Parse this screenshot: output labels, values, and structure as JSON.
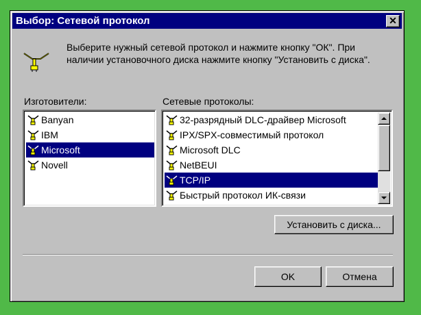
{
  "window": {
    "title": "Выбор: Сетевой протокол",
    "close_symbol": "✕"
  },
  "info": {
    "icon": "network-plug-icon",
    "text": "Выберите нужный сетевой протокол и нажмите кнопку \"ОК\". При наличии установочного диска нажмите кнопку \"Установить с диска\"."
  },
  "manufacturers": {
    "label": "Изготовители:",
    "items": [
      {
        "label": "Banyan"
      },
      {
        "label": "IBM"
      },
      {
        "label": "Microsoft"
      },
      {
        "label": "Novell"
      }
    ],
    "selected": "Microsoft"
  },
  "protocols": {
    "label": "Сетевые протоколы:",
    "items": [
      {
        "label": "32-разрядный DLC-драйвер Microsoft"
      },
      {
        "label": "IPX/SPX-совместимый протокол"
      },
      {
        "label": "Microsoft DLC"
      },
      {
        "label": "NetBEUI"
      },
      {
        "label": "TCP/IP"
      },
      {
        "label": "Быстрый протокол ИК-связи"
      }
    ],
    "selected": "TCP/IP"
  },
  "buttons": {
    "have_disk": "Установить с диска...",
    "ok": "OK",
    "cancel": "Отмена"
  },
  "colors": {
    "desktop": "#50b948",
    "titlebar": "#000080",
    "selection": "#000080",
    "face": "#c0c0c0"
  }
}
